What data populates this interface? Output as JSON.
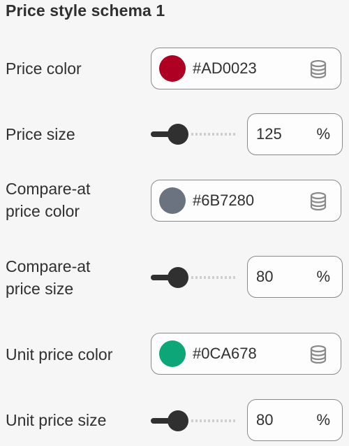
{
  "section": {
    "title": "Price style schema 1"
  },
  "settings": {
    "price_color": {
      "label": "Price color",
      "value": "#AD0023",
      "swatch": "#AD0023",
      "icon": "database-icon"
    },
    "price_size": {
      "label": "Price size",
      "value": "125",
      "unit": "%",
      "level": 0.25
    },
    "compare_color": {
      "label_line1": "Compare-at",
      "label_line2": "price color",
      "value": "#6B7280",
      "swatch": "#6B7280",
      "icon": "database-icon"
    },
    "compare_size": {
      "label_line1": "Compare-at",
      "label_line2": "price size",
      "value": "80",
      "unit": "%",
      "level": 0.25
    },
    "unit_color": {
      "label": "Unit price color",
      "value": "#0CA678",
      "swatch": "#0CA678",
      "icon": "database-icon"
    },
    "unit_size": {
      "label": "Unit price size",
      "value": "80",
      "unit": "%",
      "level": 0.25
    }
  }
}
